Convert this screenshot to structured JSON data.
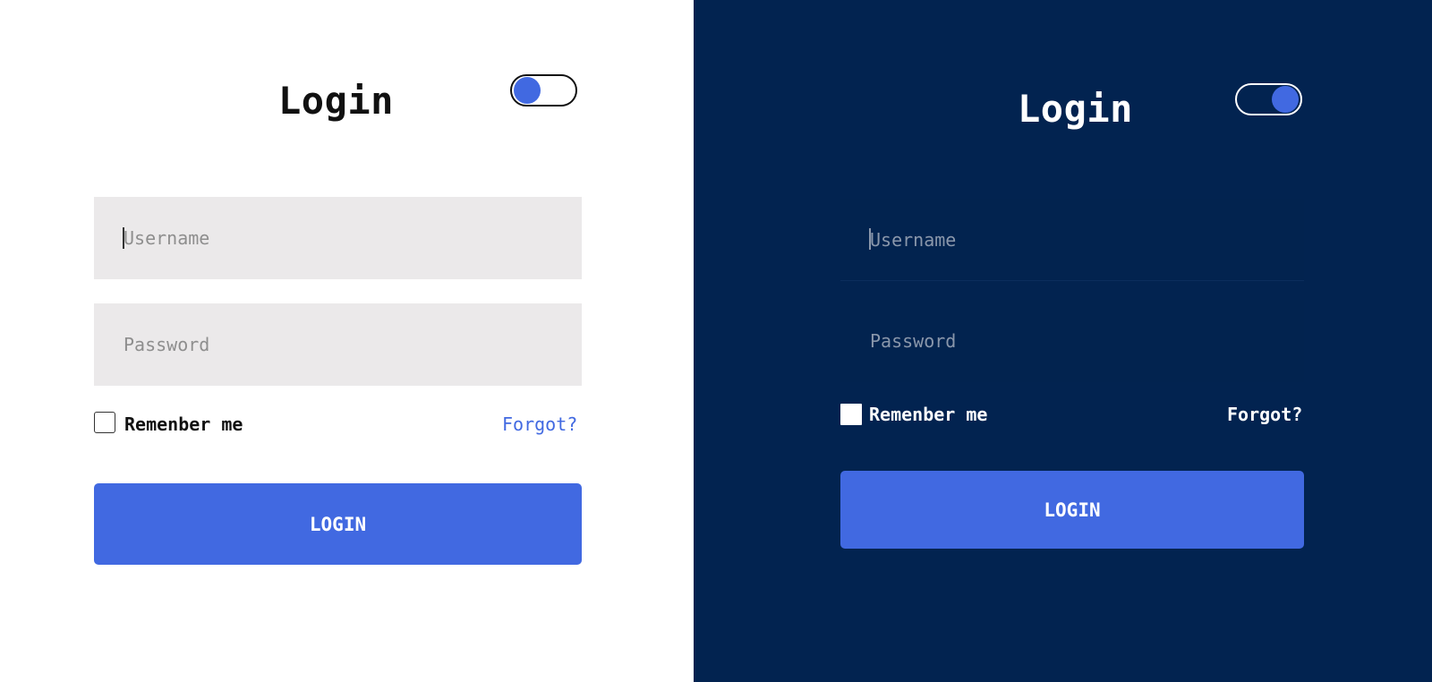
{
  "colors": {
    "accent": "#4169e1",
    "light_background": "#ffffff",
    "dark_background": "#022350",
    "light_input_background": "#ebe9ea"
  },
  "light_panel": {
    "title": "Login",
    "theme_toggle": {
      "state": "off",
      "icon": "toggle-switch-icon"
    },
    "username": {
      "placeholder": "Username",
      "value": ""
    },
    "password": {
      "placeholder": "Password",
      "value": ""
    },
    "remember_me": {
      "label": "Remenber me",
      "checked": false
    },
    "forgot_link": "Forgot?",
    "login_button": "LOGIN"
  },
  "dark_panel": {
    "title": "Login",
    "theme_toggle": {
      "state": "on",
      "icon": "toggle-switch-icon"
    },
    "username": {
      "placeholder": "Username",
      "value": ""
    },
    "password": {
      "placeholder": "Password",
      "value": ""
    },
    "remember_me": {
      "label": "Remenber me",
      "checked": false
    },
    "forgot_link": "Forgot?",
    "login_button": "LOGIN"
  }
}
